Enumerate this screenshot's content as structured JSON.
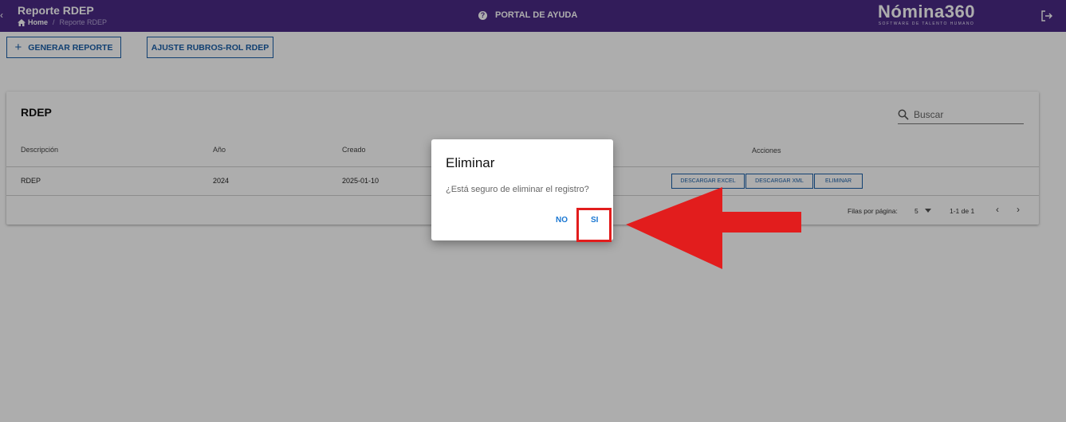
{
  "header": {
    "page_title": "Reporte RDEP",
    "breadcrumb_home": "Home",
    "breadcrumb_separator": "/",
    "breadcrumb_current": "Reporte RDEP",
    "help_label": "PORTAL DE AYUDA",
    "logo_text": "Nómina360",
    "logo_tagline": "SOFTWARE DE TALENTO HUMANO"
  },
  "toolbar": {
    "generate_label": "GENERAR REPORTE",
    "adjust_label": "AJUSTE RUBROS-ROL RDEP"
  },
  "table": {
    "title": "RDEP",
    "search_placeholder": "Buscar",
    "columns": [
      "Descripción",
      "Año",
      "Creado",
      "Acciones"
    ],
    "rows": [
      {
        "descripcion": "RDEP",
        "anio": "2024",
        "creado": "2025-01-10"
      }
    ],
    "actions": {
      "excel": "DESCARGAR EXCEL",
      "xml": "DESCARGAR XML",
      "delete": "ELIMINAR"
    },
    "footer": {
      "rows_per_page_label": "Filas por página:",
      "rows_per_page_value": "5",
      "range": "1-1 de 1"
    }
  },
  "dialog": {
    "title": "Eliminar",
    "message": "¿Está seguro de eliminar el registro?",
    "no_label": "NO",
    "yes_label": "SI"
  },
  "colors": {
    "header_bg": "#4a2a85",
    "primary": "#1a5fa8",
    "annotation": "#e21d1d"
  }
}
